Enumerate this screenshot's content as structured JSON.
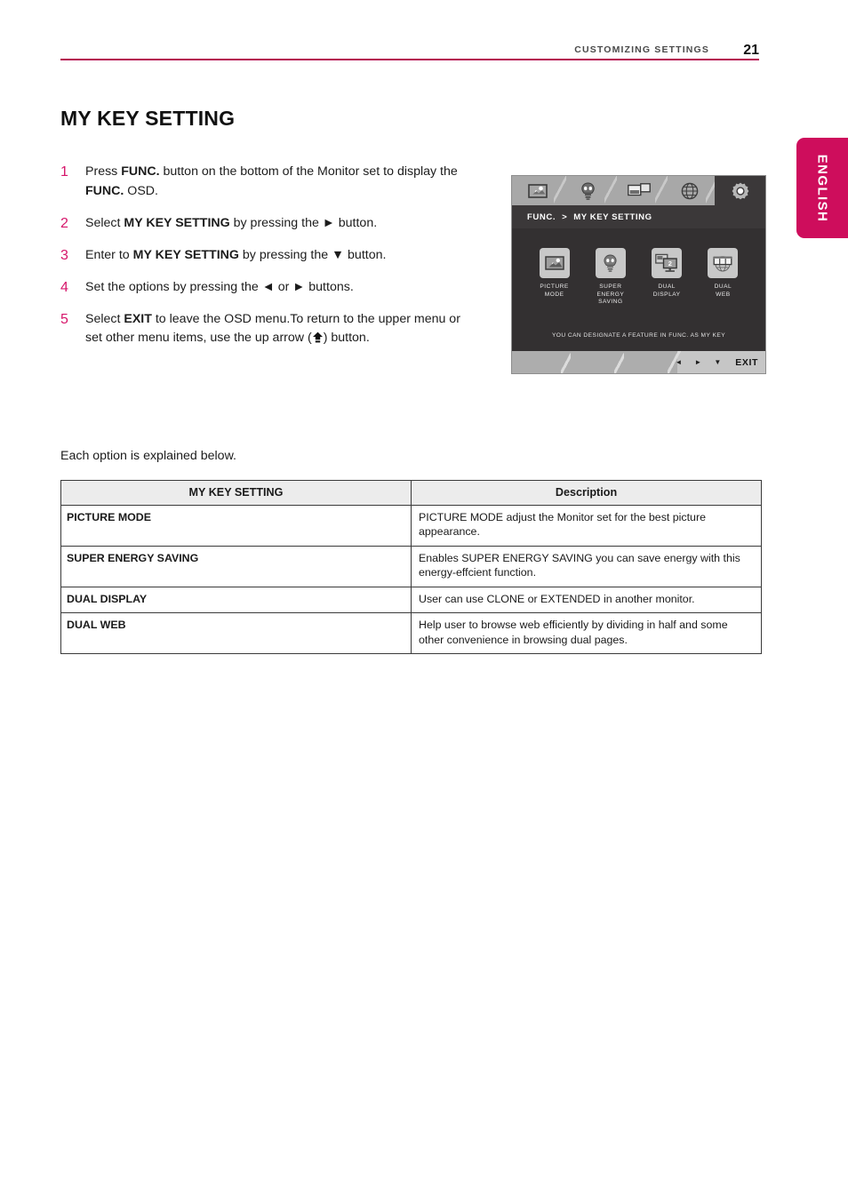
{
  "header": {
    "title": "CUSTOMIZING SETTINGS",
    "page_number": "21",
    "rule_color": "#b4054f"
  },
  "language_tab": {
    "label": "ENGLISH",
    "color": "#ce0d5c"
  },
  "section": {
    "title": "MY KEY SETTING",
    "number_color": "#d6156a"
  },
  "steps": [
    {
      "number": "1",
      "parts": [
        {
          "t": "Press ",
          "b": false
        },
        {
          "t": "FUNC.",
          "b": true
        },
        {
          "t": " button on the bottom of the Monitor set to display the ",
          "b": false
        },
        {
          "t": "FUNC.",
          "b": true
        },
        {
          "t": " OSD.",
          "b": false
        }
      ]
    },
    {
      "number": "2",
      "parts": [
        {
          "t": "Select ",
          "b": false
        },
        {
          "t": "MY KEY SETTING",
          "b": true
        },
        {
          "t": " by pressing the ► button.",
          "b": false
        }
      ]
    },
    {
      "number": "3",
      "parts": [
        {
          "t": "Enter to ",
          "b": false
        },
        {
          "t": "MY KEY SETTING",
          "b": true
        },
        {
          "t": " by pressing the ▼ button.",
          "b": false
        }
      ]
    },
    {
      "number": "4",
      "parts": [
        {
          "t": "Set the options by pressing the ◄ or ► buttons.",
          "b": false
        }
      ]
    },
    {
      "number": "5",
      "parts": [
        {
          "t": "Select ",
          "b": false
        },
        {
          "t": "EXIT",
          "b": true
        },
        {
          "t": " to leave the OSD menu.To return to the upper menu or set other menu items, use the up arrow   (",
          "b": false
        }
      ],
      "suffix": ") button.",
      "has_up_arrow": true
    }
  ],
  "osd": {
    "tabs": [
      {
        "icon": "picture-mode-icon",
        "active": false
      },
      {
        "icon": "lightbulb-icon",
        "active": false
      },
      {
        "icon": "dual-display-icon",
        "active": false
      },
      {
        "icon": "globe-icon",
        "active": false
      },
      {
        "icon": "gear-icon",
        "active": true
      }
    ],
    "breadcrumb_root": "FUNC.",
    "breadcrumb_sep": ">",
    "breadcrumb_current": "MY KEY SETTING",
    "options": [
      {
        "label": "PICTURE\nMODE",
        "icon": "picture-mode-icon"
      },
      {
        "label": "SUPER\nENERGY\nSAVING",
        "icon": "lightbulb-icon"
      },
      {
        "label": "DUAL\nDISPLAY",
        "icon": "dual-display-icon"
      },
      {
        "label": "DUAL\nWEB",
        "icon": "dual-web-icon"
      }
    ],
    "hint": "YOU CAN DESIGNATE A FEATURE IN FUNC. AS MY KEY",
    "footer": {
      "left_arrow": "◄",
      "right_arrow": "►",
      "down_arrow": "▼",
      "exit_label": "EXIT"
    }
  },
  "table_intro": "Each option is explained below.",
  "table": {
    "headers": [
      "MY KEY SETTING",
      "Description"
    ],
    "rows": [
      {
        "name": "PICTURE MODE",
        "description": "PICTURE MODE adjust the Monitor set for the best picture appearance."
      },
      {
        "name": "SUPER ENERGY SAVING",
        "description": "Enables SUPER ENERGY SAVING you can save energy with this energy-effcient function."
      },
      {
        "name": "DUAL DISPLAY",
        "description": "User can use CLONE or EXTENDED in another monitor."
      },
      {
        "name": "DUAL WEB",
        "description": "Help user to browse web efficiently by dividing in half and some other convenience in browsing dual pages."
      }
    ]
  }
}
